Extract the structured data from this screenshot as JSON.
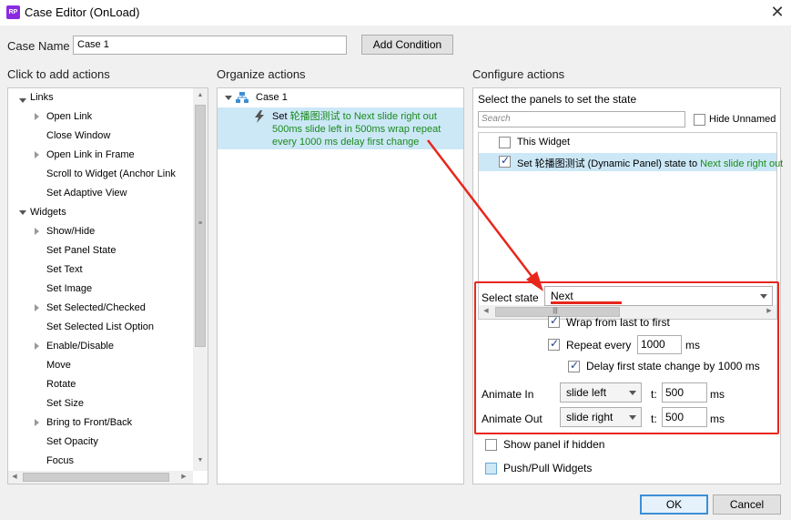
{
  "window": {
    "app_icon_text": "RP",
    "title": "Case Editor (OnLoad)",
    "close_glyph": "✕"
  },
  "case_name": {
    "label": "Case Name",
    "value": "Case 1",
    "add_condition": "Add Condition"
  },
  "columns": {
    "left": "Click to add actions",
    "middle": "Organize actions",
    "right": "Configure actions"
  },
  "actions_tree": {
    "links_group": "Links",
    "links": [
      "Open Link",
      "Close Window",
      "Open Link in Frame",
      "Scroll to Widget (Anchor Link",
      "Set Adaptive View"
    ],
    "widgets_group": "Widgets",
    "widgets": [
      "Show/Hide",
      "Set Panel State",
      "Set Text",
      "Set Image",
      "Set Selected/Checked",
      "Set Selected List Option",
      "Enable/Disable",
      "Move",
      "Rotate",
      "Set Size",
      "Bring to Front/Back",
      "Set Opacity",
      "Focus"
    ]
  },
  "organize": {
    "case_label": "Case 1",
    "action_prefix": "Set ",
    "action_line1_green": "轮播图测试 to Next slide right out",
    "action_line2": "500ms slide left in 500ms wrap repeat",
    "action_line3": "every 1000 ms delay first change"
  },
  "configure": {
    "panels_title": "Select the panels to set the state",
    "search_placeholder": "Search",
    "hide_unnamed": "Hide Unnamed",
    "this_widget": "This Widget",
    "row_set_prefix": "Set ",
    "row_set_mid": "轮播图测试 (Dynamic Panel) state to ",
    "row_set_green": "Next slide right out",
    "select_state_label": "Select state",
    "select_state_value": "Next",
    "wrap_label": "Wrap from last to first",
    "repeat_label": "Repeat every",
    "repeat_value": "1000",
    "repeat_unit": "ms",
    "delay_label": "Delay first state change by 1000 ms",
    "animate_in_label": "Animate In",
    "animate_in_value": "slide left",
    "animate_in_t": "t:",
    "animate_in_ms": "500",
    "animate_in_unit": "ms",
    "animate_out_label": "Animate Out",
    "animate_out_value": "slide right",
    "animate_out_t": "t:",
    "animate_out_ms": "500",
    "animate_out_unit": "ms",
    "show_panel": "Show panel if hidden",
    "push_pull": "Push/Pull Widgets"
  },
  "footer": {
    "ok": "OK",
    "cancel": "Cancel"
  },
  "colors": {
    "selection": "#cce8f7",
    "highlight_red": "#e8261c",
    "green_text": "#1b8a1b"
  }
}
